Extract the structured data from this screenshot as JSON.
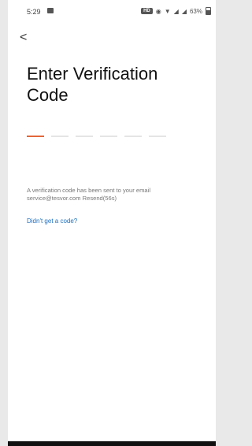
{
  "status": {
    "time": "5:29",
    "hd": "HD",
    "battery": "63%",
    "icons": [
      "gallery-icon",
      "vibrate-icon",
      "wifi-icon",
      "signal-icon",
      "signal-icon",
      "battery-icon"
    ]
  },
  "nav": {
    "back_glyph": "<"
  },
  "title": "Enter Verification Code",
  "code": {
    "length": 6,
    "active_index": 0,
    "accent": "#e2673a"
  },
  "info": {
    "line1": "A verification code has been sent to your email",
    "email": "service@tesvor.com",
    "resend": "Resend(56s)"
  },
  "help_link": "Didn't get a code?",
  "colors": {
    "link": "#1d6fbf",
    "accent": "#e2673a"
  }
}
